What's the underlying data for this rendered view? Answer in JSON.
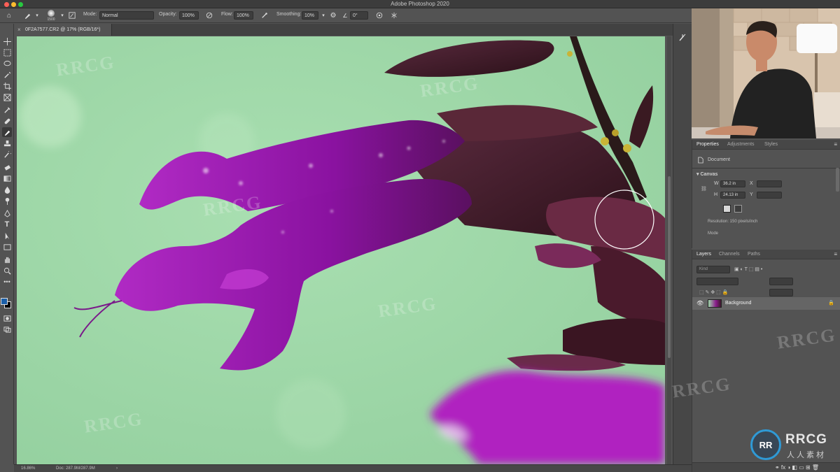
{
  "app": {
    "title": "Adobe Photoshop 2020"
  },
  "options_bar": {
    "mode_label": "Mode:",
    "mode_value": "Normal",
    "opacity_label": "Opacity:",
    "opacity_value": "100%",
    "flow_label": "Flow:",
    "flow_value": "100%",
    "smoothing_label": "Smoothing:",
    "smoothing_value": "10%",
    "angle_value": "0°",
    "brush_size": "1500"
  },
  "document": {
    "tab_title": "0F2A7577.CR2 @ 17% (RGB/16*)",
    "zoom": "16.86%",
    "doc_size": "Doc: 287.9M/287.9M"
  },
  "properties_panel": {
    "tabs": [
      "Properties",
      "Adjustments",
      "Styles"
    ],
    "active_tab": "Properties",
    "doc_type": "Document",
    "section": "Canvas",
    "width_label": "W",
    "width_value": "36.2 in",
    "height_label": "H",
    "height_value": "24.13 in",
    "x_label": "X",
    "y_label": "Y",
    "resolution": "Resolution: 150 pixels/inch",
    "mode_label": "Mode"
  },
  "layers_panel": {
    "tabs": [
      "Layers",
      "Channels",
      "Paths"
    ],
    "active_tab": "Layers",
    "filter_placeholder": "Kind",
    "layers": [
      {
        "name": "Background",
        "locked": true,
        "visible": true
      }
    ]
  },
  "watermark": {
    "text": "RRCG",
    "logo_main": "RRCG",
    "logo_sub": "人人素材"
  },
  "colors": {
    "ui_bg": "#535353",
    "foreground_swatch": "#1b5fa8",
    "background_swatch": "#000000",
    "canvas_bg": "#9fd8a9",
    "flower_purple": "#8a12a0"
  }
}
